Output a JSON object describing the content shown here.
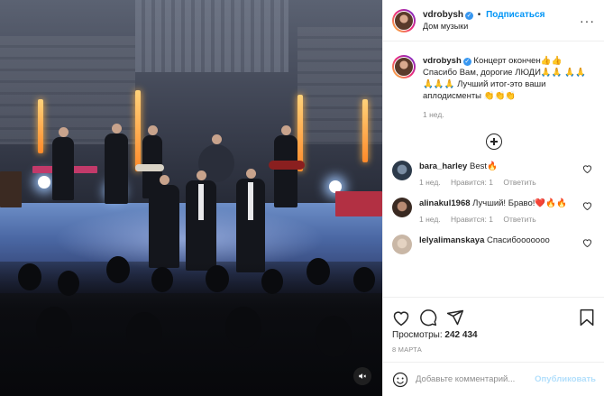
{
  "post": {
    "username": "vdrobysh",
    "follow_label": "Подписаться",
    "location": "Дом музыки",
    "caption_text": "Концерт окончен👍👍 Спасибо Вам, дорогие ЛЮДИ🙏🙏 🙏🙏🙏🙏🙏 Лучший итог-это ваши аплодисменты 👏👏👏",
    "caption_time": "1 нед.",
    "views_label": "Просмотры:",
    "views_count": "242 434",
    "date": "8 МАРТА"
  },
  "comments": [
    {
      "username": "bara_harley",
      "text": "Best🔥",
      "time": "1 нед.",
      "likes": "Нравится: 1",
      "reply": "Ответить",
      "avatar_color": "#2c3a4a"
    },
    {
      "username": "alinakul1968",
      "text": "Лучший! Браво!❤️🔥🔥",
      "time": "1 нед.",
      "likes": "Нравится: 1",
      "reply": "Ответить",
      "avatar_color": "#3a2a22"
    },
    {
      "username": "lelyalimanskaya",
      "text": "Спасибооооооо",
      "time": "",
      "likes": "",
      "reply": "",
      "avatar_color": "#c9b7a6"
    }
  ],
  "comment_input": {
    "placeholder": "Добавьте комментарий...",
    "publish_label": "Опубликовать"
  },
  "icons": {
    "more": "more-options-icon",
    "verified": "verified-badge-icon",
    "load_more": "plus-circle-icon",
    "like": "heart-icon",
    "comment": "comment-icon",
    "share": "share-icon",
    "save": "bookmark-icon",
    "emoji": "emoji-icon",
    "mute": "speaker-muted-icon"
  },
  "colors": {
    "link": "#0095f6",
    "publish_disabled": "#b2dffc",
    "verified": "#3897f0",
    "secondary_text": "#8e8e8e"
  }
}
